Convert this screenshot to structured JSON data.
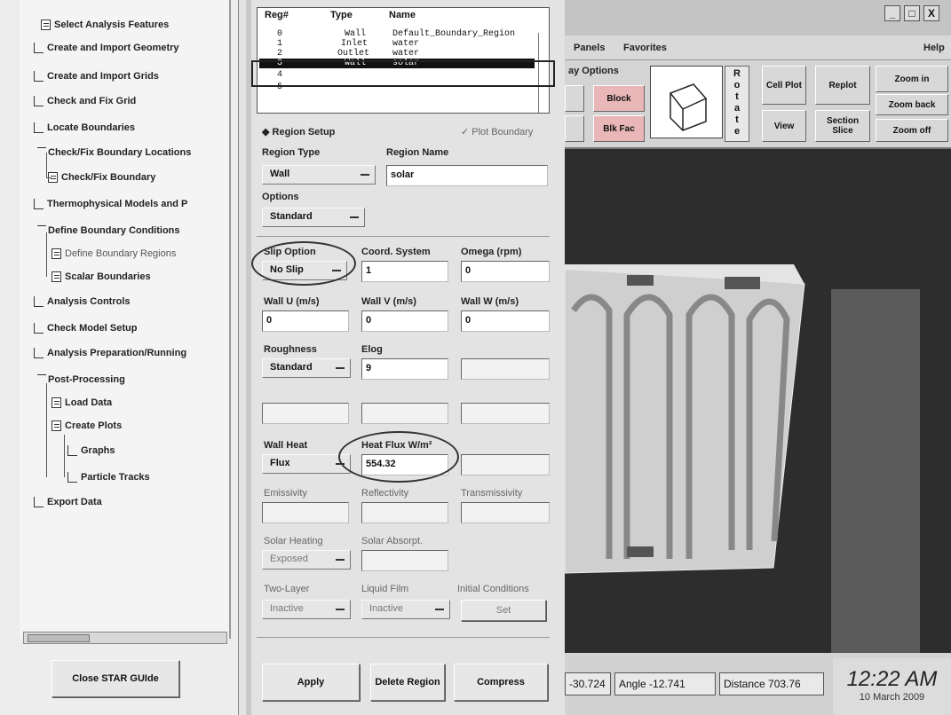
{
  "tree": {
    "items": [
      {
        "label": "Select Analysis Features",
        "icon": "page-icon"
      },
      {
        "label": "Create and Import Geometry",
        "icon": "step-icon"
      },
      {
        "label": "Create and Import Grids",
        "icon": "step-icon"
      },
      {
        "label": "Check and Fix Grid",
        "icon": "step-icon"
      },
      {
        "label": "Locate Boundaries",
        "icon": "step-icon"
      },
      {
        "label": "Check/Fix Boundary Locations",
        "icon": "folder-icon"
      },
      {
        "label": "Check/Fix Boundary",
        "icon": "page-icon"
      },
      {
        "label": "Thermophysical Models and P",
        "icon": "step-icon"
      },
      {
        "label": "Define Boundary Conditions",
        "icon": "folder-icon"
      },
      {
        "label": "Define Boundary Regions",
        "icon": "page-icon"
      },
      {
        "label": "Scalar Boundaries",
        "icon": "page-icon"
      },
      {
        "label": "Analysis Controls",
        "icon": "step-icon"
      },
      {
        "label": "Check Model Setup",
        "icon": "step-icon"
      },
      {
        "label": "Analysis Preparation/Running",
        "icon": "step-icon"
      },
      {
        "label": "Post-Processing",
        "icon": "folder-icon"
      },
      {
        "label": "Load Data",
        "icon": "page-icon"
      },
      {
        "label": "Create Plots",
        "icon": "page-icon"
      },
      {
        "label": "Graphs",
        "icon": "step-icon"
      },
      {
        "label": "Particle Tracks",
        "icon": "step-icon"
      },
      {
        "label": "Export Data",
        "icon": "step-icon"
      }
    ],
    "close_button": "Close STAR GUIde"
  },
  "regions": {
    "headers": [
      "Reg#",
      "Type",
      "Name"
    ],
    "rows": [
      {
        "num": "0",
        "type": "Wall",
        "name": "Default_Boundary_Region"
      },
      {
        "num": "1",
        "type": "Inlet",
        "name": "water"
      },
      {
        "num": "2",
        "type": "Outlet",
        "name": "water"
      },
      {
        "num": "3",
        "type": "Wall",
        "name": "solar"
      },
      {
        "num": "4",
        "type": "",
        "name": ""
      },
      {
        "num": "5",
        "type": "",
        "name": ""
      }
    ]
  },
  "setup": {
    "region_setup": "Region Setup",
    "plot_boundary": "Plot Boundary",
    "region_type_label": "Region Type",
    "region_type": "Wall",
    "region_name_label": "Region Name",
    "region_name": "solar",
    "options_label": "Options",
    "options": "Standard",
    "slip_label": "Slip Option",
    "slip": "No Slip",
    "coord_label": "Coord. System",
    "coord": "1",
    "omega_label": "Omega (rpm)",
    "omega": "0",
    "wall_u_label": "Wall U (m/s)",
    "wall_u": "0",
    "wall_v_label": "Wall V (m/s)",
    "wall_v": "0",
    "wall_w_label": "Wall W (m/s)",
    "wall_w": "0",
    "roughness_label": "Roughness",
    "roughness": "Standard",
    "elog_label": "Elog",
    "elog": "9",
    "wall_heat_label": "Wall Heat",
    "wall_heat": "Flux",
    "heat_flux_label": "Heat Flux W/m²",
    "heat_flux": "554.32",
    "emissivity_label": "Emissivity",
    "reflectivity_label": "Reflectivity",
    "transmissivity_label": "Transmissivity",
    "solar_heating_label": "Solar Heating",
    "solar_heating": "Exposed",
    "solar_absorpt_label": "Solar Absorpt.",
    "two_layer_label": "Two-Layer",
    "two_layer": "Inactive",
    "liquid_film_label": "Liquid Film",
    "liquid_film": "Inactive",
    "initial_cond_label": "Initial Conditions",
    "initial_cond": "Set"
  },
  "actions": {
    "apply": "Apply",
    "delete": "Delete Region",
    "compress": "Compress"
  },
  "viewer": {
    "window_buttons": [
      "_",
      "□",
      "X"
    ],
    "menu": [
      "Panels",
      "Favorites"
    ],
    "help": "Help",
    "display_options": "ay Options",
    "block": "Block",
    "blk_fac": "Blk Fac",
    "rotate_letters": [
      "R",
      "o",
      "t",
      "a",
      "t",
      "e"
    ],
    "cell_plot": "Cell Plot",
    "replot": "Replot",
    "zoom_in": "Zoom in",
    "zoom_back": "Zoom back",
    "view": "View",
    "section_slice": "Section Slice",
    "zoom_off": "Zoom off",
    "status": {
      "elevation": "-30.724",
      "angle": "Angle -12.741",
      "distance": "Distance 703.76"
    }
  },
  "clock": {
    "time": "12:22 AM",
    "date": "10 March 2009"
  },
  "colors": {
    "selected_row": "#111111",
    "canvas_bg": "#2d2d2d",
    "pink_button": "#e9b7b7"
  }
}
